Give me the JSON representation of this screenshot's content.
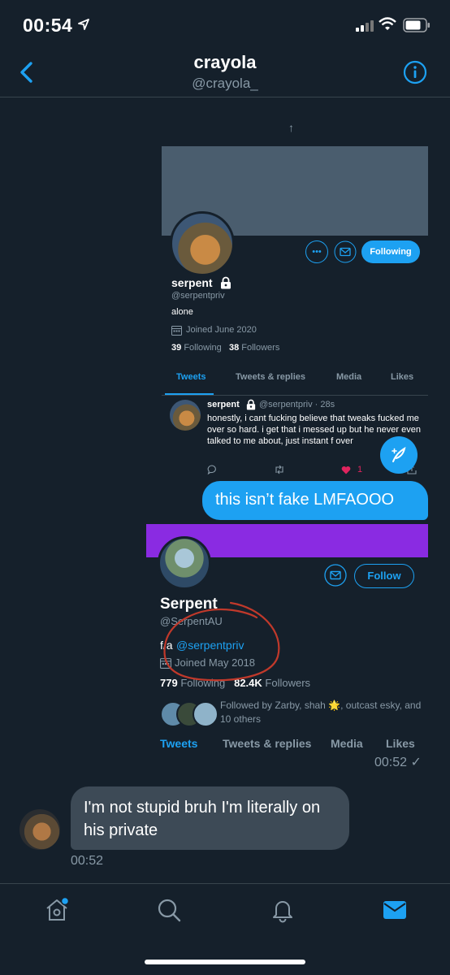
{
  "status_bar": {
    "time": "00:54"
  },
  "header": {
    "title": "crayola",
    "subtitle": "@crayola_"
  },
  "shot1": {
    "follow_button": "Following",
    "name": "serpent",
    "handle": "@serpentpriv",
    "bio": "alone",
    "joined": "Joined June 2020",
    "following_count": "39",
    "following_label": "Following",
    "followers_count": "38",
    "followers_label": "Followers",
    "tabs": [
      "Tweets",
      "Tweets & replies",
      "Media",
      "Likes"
    ],
    "tweet": {
      "name": "serpent",
      "handle_time": "@serpentpriv · 28s",
      "text": "honestly, i cant fucking believe that tweaks fucked me over so hard. i get that i messed up but he never even talked to me about, just instant f over",
      "like_count": "1"
    }
  },
  "message_sent_1": {
    "text": "this isn’t fake LMFAOOO"
  },
  "shot2": {
    "follow_button": "Follow",
    "name": "Serpent",
    "handle": "@SerpentAU",
    "bio_prefix": "f/a",
    "bio_link": "@serpentpriv",
    "joined": "Joined May 2018",
    "following_count": "779",
    "following_label": "Following",
    "followers_count": "82.4K",
    "followers_label": "Followers",
    "followed_by": "Followed by Zarby, shah 🌟, outcast esky, and 10 others",
    "tabs": [
      "Tweets",
      "Tweets & replies",
      "Media",
      "Likes"
    ]
  },
  "sent_timestamp": "00:52 ✓",
  "message_received_1": {
    "text": "I'm not stupid bruh I'm literally on his private",
    "timestamp": "00:52"
  },
  "colors": {
    "accent": "#1da1f2",
    "background": "#15202b",
    "banner_purple": "#8a2be2",
    "annotation_red": "#c0392b"
  },
  "tabbar_icons": [
    "home-icon",
    "search-icon",
    "notifications-icon",
    "messages-icon"
  ]
}
